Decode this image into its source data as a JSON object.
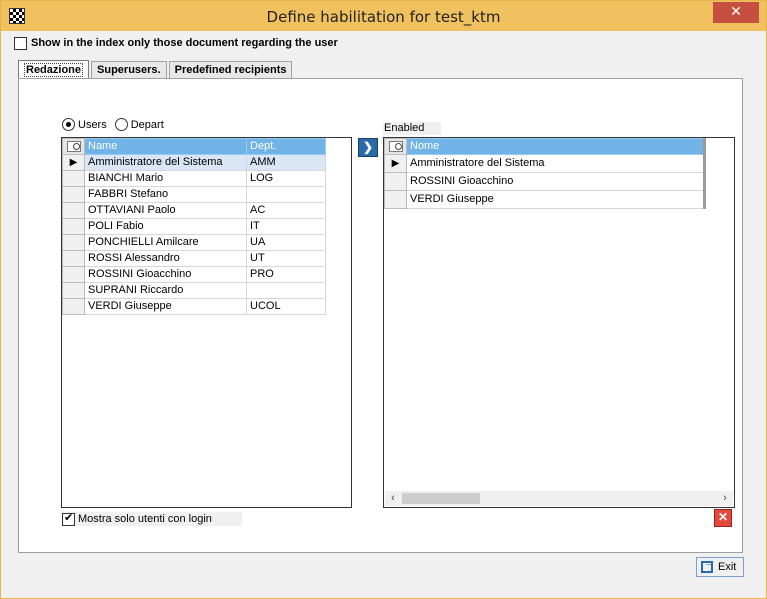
{
  "window": {
    "title": "Define habilitation for test_ktm",
    "close_glyph": "✕",
    "accent_color": "#f1c15f",
    "close_color": "#c74f3f"
  },
  "top_option": {
    "label": "Show in the index only those document regarding the user",
    "checked": false
  },
  "tabs": [
    {
      "label": "Redazione",
      "active": true
    },
    {
      "label": "Superusers.",
      "active": false
    },
    {
      "label": "Predefined recipients",
      "active": false
    }
  ],
  "filter": {
    "users_label": "Users",
    "depart_label": "Depart",
    "selected": "Users"
  },
  "left_grid": {
    "headers": {
      "name": "Name",
      "dept": "Dept."
    },
    "header_color": "#70b3e6",
    "rows": [
      {
        "name": "Amministratore del Sistema",
        "dept": "AMM",
        "current": "▶"
      },
      {
        "name": "BIANCHI Mario",
        "dept": "LOG",
        "current": ""
      },
      {
        "name": "FABBRI Stefano",
        "dept": "",
        "current": ""
      },
      {
        "name": "OTTAVIANI Paolo",
        "dept": "AC",
        "current": ""
      },
      {
        "name": "POLI Fabio",
        "dept": "IT",
        "current": ""
      },
      {
        "name": "PONCHIELLI Amilcare",
        "dept": "UA",
        "current": ""
      },
      {
        "name": "ROSSI Alessandro",
        "dept": "UT",
        "current": ""
      },
      {
        "name": "ROSSINI Gioacchino",
        "dept": "PRO",
        "current": ""
      },
      {
        "name": "SUPRANI Riccardo",
        "dept": "",
        "current": ""
      },
      {
        "name": "VERDI Giuseppe",
        "dept": "UCOL",
        "current": ""
      }
    ]
  },
  "move_button": {
    "glyph": "❯"
  },
  "right_grid": {
    "caption": "Enabled",
    "headers": {
      "name": "Nome"
    },
    "rows": [
      {
        "name": "Amministratore del Sistema",
        "current": "▶"
      },
      {
        "name": "ROSSINI Gioacchino",
        "current": ""
      },
      {
        "name": "VERDI Giuseppe",
        "current": ""
      }
    ],
    "scroll_left": "‹",
    "scroll_right": "›"
  },
  "bottom_option": {
    "label": "Mostra solo utenti con login",
    "checked": true
  },
  "remove_button": {
    "glyph": "✕"
  },
  "exit_button": {
    "label": "Exit"
  }
}
